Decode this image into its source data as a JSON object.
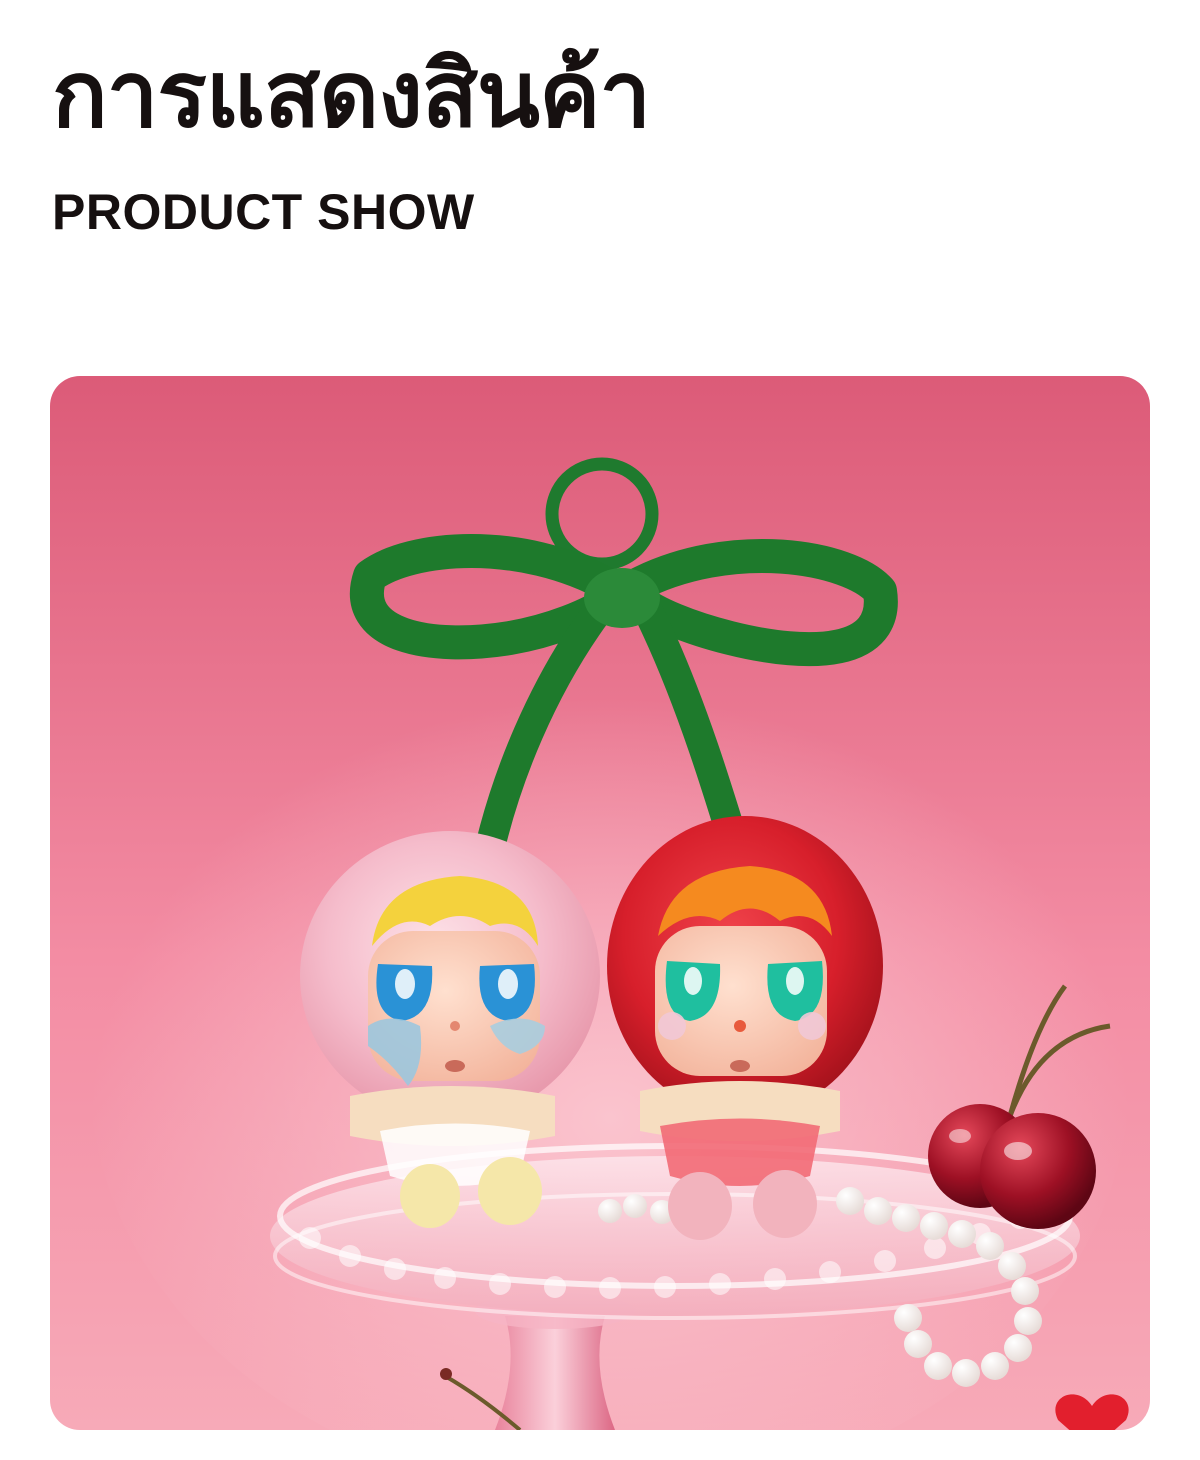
{
  "header": {
    "title": "การแสดงสินค้า",
    "subtitle": "PRODUCT SHOW"
  },
  "product_photo": {
    "subject": "two crying-baby plush charm keychains with pink and red fluffy cherry hoods on a green velvet bow ring, displayed on a glass cake stand with pearls and cherries",
    "colors": {
      "background_top": "#df5f7c",
      "background_bottom": "#f7a7b6",
      "bow_green": "#1f7a2e",
      "pink_fur": "#f4b9c7",
      "red_fur": "#d8202c"
    }
  }
}
